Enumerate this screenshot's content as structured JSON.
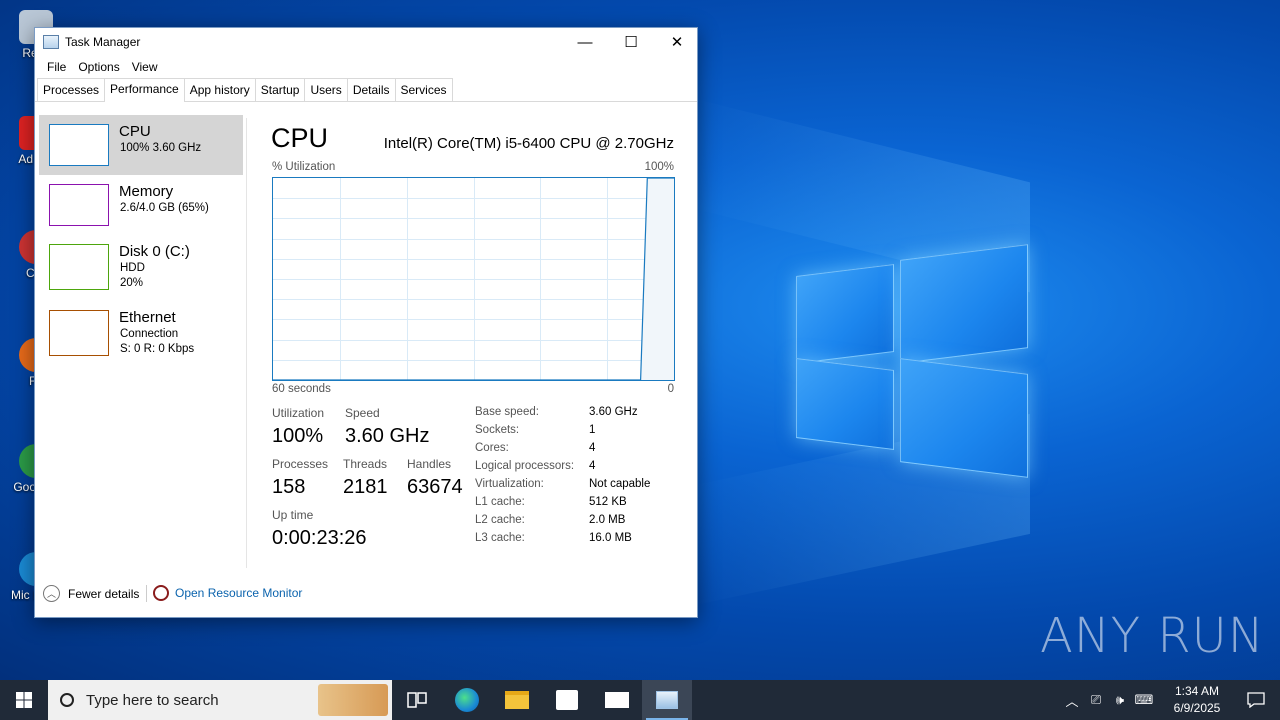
{
  "desktop": {
    "icons": [
      {
        "label": "Recy",
        "color": "#b9c7d6"
      },
      {
        "label": "Ad Acr",
        "color": "#d22"
      },
      {
        "label": "CCl",
        "color": "#c33"
      },
      {
        "label": "Fir",
        "color": "#e66a1a"
      },
      {
        "label": "Goo Chr",
        "color": "#2b9b48"
      },
      {
        "label": "Mic Edge",
        "color": "#1a8ad4"
      }
    ],
    "watermark": "ANY RUN"
  },
  "window": {
    "title": "Task Manager",
    "controls": {
      "minimize": "—",
      "maximize": "☐",
      "close": "✕"
    },
    "menu": [
      "File",
      "Options",
      "View"
    ],
    "tabs": [
      "Processes",
      "Performance",
      "App history",
      "Startup",
      "Users",
      "Details",
      "Services"
    ],
    "active_tab": "Performance"
  },
  "resources": [
    {
      "name": "CPU",
      "line1": "100%  3.60 GHz",
      "line2": "",
      "color": "#1a7ac0",
      "selected": true,
      "level": 1.0
    },
    {
      "name": "Memory",
      "line1": "2.6/4.0 GB (65%)",
      "line2": "",
      "color": "#8b12ae",
      "selected": false,
      "level": 0.65
    },
    {
      "name": "Disk 0 (C:)",
      "line1": "HDD",
      "line2": "20%",
      "color": "#4da60c",
      "selected": false,
      "level": 0.2
    },
    {
      "name": "Ethernet",
      "line1": "Connection",
      "line2": "S: 0 R: 0 Kbps",
      "color": "#a74f01",
      "selected": false,
      "level": 0
    }
  ],
  "cpu": {
    "title": "CPU",
    "model": "Intel(R) Core(TM) i5-6400 CPU @ 2.70GHz",
    "util_label": "% Utilization",
    "util_max": "100%",
    "time_left": "60 seconds",
    "time_right": "0",
    "stats": {
      "utilization_label": "Utilization",
      "utilization": "100%",
      "speed_label": "Speed",
      "speed": "3.60 GHz",
      "processes_label": "Processes",
      "processes": "158",
      "threads_label": "Threads",
      "threads": "2181",
      "handles_label": "Handles",
      "handles": "63674",
      "uptime_label": "Up time",
      "uptime": "0:00:23:26"
    },
    "specs": [
      {
        "k": "Base speed:",
        "v": "3.60 GHz"
      },
      {
        "k": "Sockets:",
        "v": "1"
      },
      {
        "k": "Cores:",
        "v": "4"
      },
      {
        "k": "Logical processors:",
        "v": "4"
      },
      {
        "k": "Virtualization:",
        "v": "Not capable"
      },
      {
        "k": "L1 cache:",
        "v": "512 KB"
      },
      {
        "k": "L2 cache:",
        "v": "2.0 MB"
      },
      {
        "k": "L3 cache:",
        "v": "16.0 MB"
      }
    ]
  },
  "chart_data": {
    "type": "area",
    "x": [
      60,
      5,
      4,
      3,
      0
    ],
    "values": [
      0,
      0,
      100,
      100,
      100
    ],
    "xlabel": "60 seconds",
    "ylabel": "% Utilization",
    "ylim": [
      0,
      100
    ],
    "grid": true
  },
  "footer": {
    "fewer_details": "Fewer details",
    "resource_monitor": "Open Resource Monitor"
  },
  "taskbar": {
    "search_placeholder": "Type here to search",
    "time": "1:34 AM",
    "date": "6/9/2025"
  }
}
